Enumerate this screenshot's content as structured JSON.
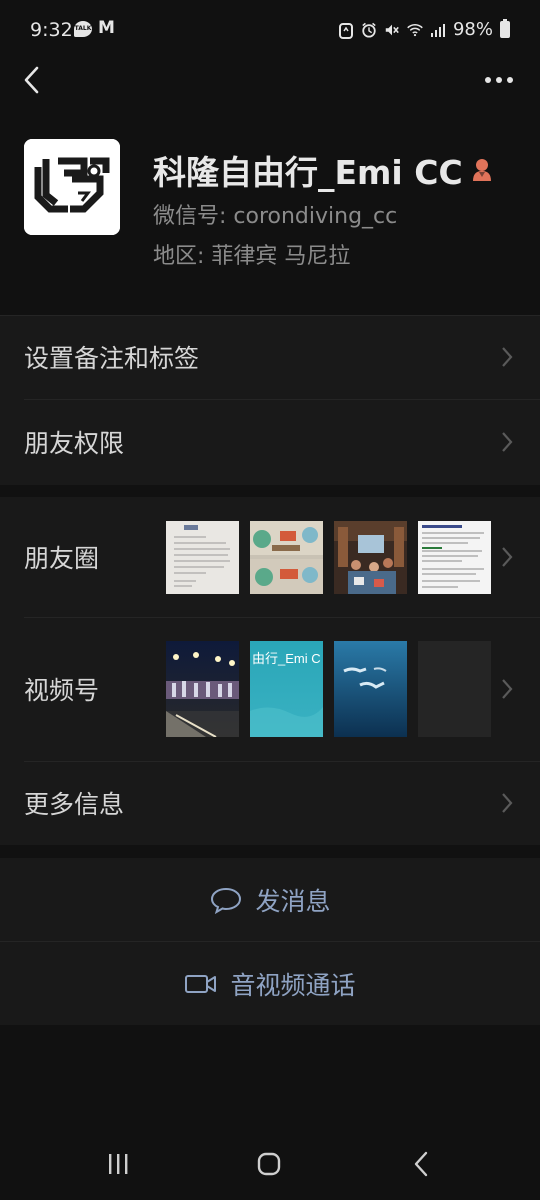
{
  "status_bar": {
    "time": "9:32",
    "left_icons": [
      "kakaotalk-icon",
      "gmail-icon"
    ],
    "gmail_glyph": "M",
    "talk_glyph": "TALK",
    "battery": "98%",
    "right_icons": [
      "recycle-icon",
      "alarm-icon",
      "mute-icon",
      "wifi-icon",
      "signal-icon",
      "battery-icon"
    ]
  },
  "header": {
    "back_icon": "back-arrow-icon",
    "more_icon": "more-dots-icon"
  },
  "profile": {
    "name": "科隆自由行_Emi CC",
    "gender_icon": "female-icon",
    "wechat_id": "微信号: corondiving_cc",
    "region": "地区: 菲律宾  马尼拉"
  },
  "cells_top": [
    {
      "label": "设置备注和标签"
    },
    {
      "label": "朋友权限"
    }
  ],
  "moments": {
    "label": "朋友圈",
    "thumbs": [
      "document-photo",
      "banner-photo",
      "restaurant-photo",
      "screenshot-photo"
    ]
  },
  "channels": {
    "label": "视频号",
    "thumbs": [
      "night-street-video",
      "teal-title-video",
      "underwater-video",
      "blank-video"
    ],
    "thumb2_text": "由行_Emi C"
  },
  "more_info": {
    "label": "更多信息"
  },
  "actions": [
    {
      "label": "发消息",
      "icon": "chat-bubble-icon"
    },
    {
      "label": "音视频通话",
      "icon": "video-camera-icon"
    }
  ],
  "colors": {
    "background": "#111111",
    "cell": "#191919",
    "action_text": "#8fa3c3",
    "gender": "#e0735a"
  }
}
